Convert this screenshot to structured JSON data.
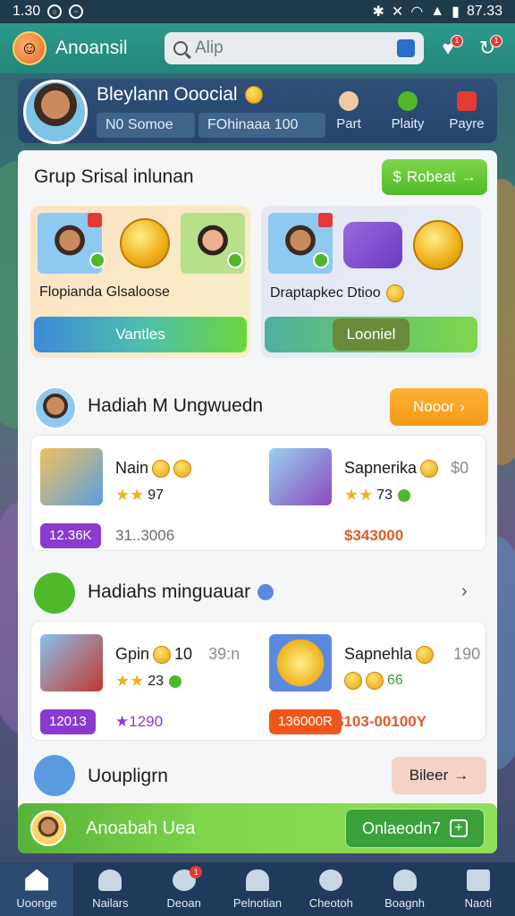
{
  "status_bar": {
    "time": "1.30",
    "right_text": "87.33"
  },
  "header": {
    "app_name": "Anoansil",
    "search_placeholder": "Alip",
    "notif_count": "1",
    "msg_count": "1"
  },
  "profile": {
    "name": "Bleylann Ooocial",
    "pill_left": "N0 Somoe",
    "pill_right": "FOhinaaa 100",
    "actions": [
      {
        "label": "Part"
      },
      {
        "label": "Plaity"
      },
      {
        "label": "Payre"
      }
    ]
  },
  "group": {
    "title": "Grup Srisal inlunan",
    "button": "Robeat",
    "promo_a": {
      "label": "Flopianda Glsaloose",
      "button": "Vantles"
    },
    "promo_b": {
      "label": "Draptapkec Dtioo",
      "button": "Looniel"
    }
  },
  "rewards": {
    "title": "Hadiah M Ungwuedn",
    "button": "Nooor",
    "items": [
      {
        "title": "Nain",
        "stars": "97",
        "chip": "12.36K",
        "value": "31..3006"
      },
      {
        "title": "Sapnerika",
        "extra": "$0",
        "stars": "73",
        "value": "$343000"
      }
    ]
  },
  "weekly": {
    "title": "Hadiahs minguauar",
    "items": [
      {
        "title": "Gpin",
        "extra": "10",
        "extra2": "39:n",
        "stars": "23",
        "chip": "12013",
        "value": "1290"
      },
      {
        "title": "Sapnehla",
        "extra": "190",
        "stars": "66",
        "chip": "136000R",
        "value": "$103-00100Y"
      }
    ]
  },
  "upgrade": {
    "title": "Uoupligrn",
    "button": "Bileer"
  },
  "cta": {
    "title": "Anoabah Uea",
    "button": "Onlaeodn7"
  },
  "tabs": [
    {
      "label": "Uoonge"
    },
    {
      "label": "Nailars"
    },
    {
      "label": "Deoan",
      "badge": "1"
    },
    {
      "label": "Pelnotian"
    },
    {
      "label": "Cheotoh"
    },
    {
      "label": "Boagnh"
    },
    {
      "label": "Naoti"
    }
  ]
}
